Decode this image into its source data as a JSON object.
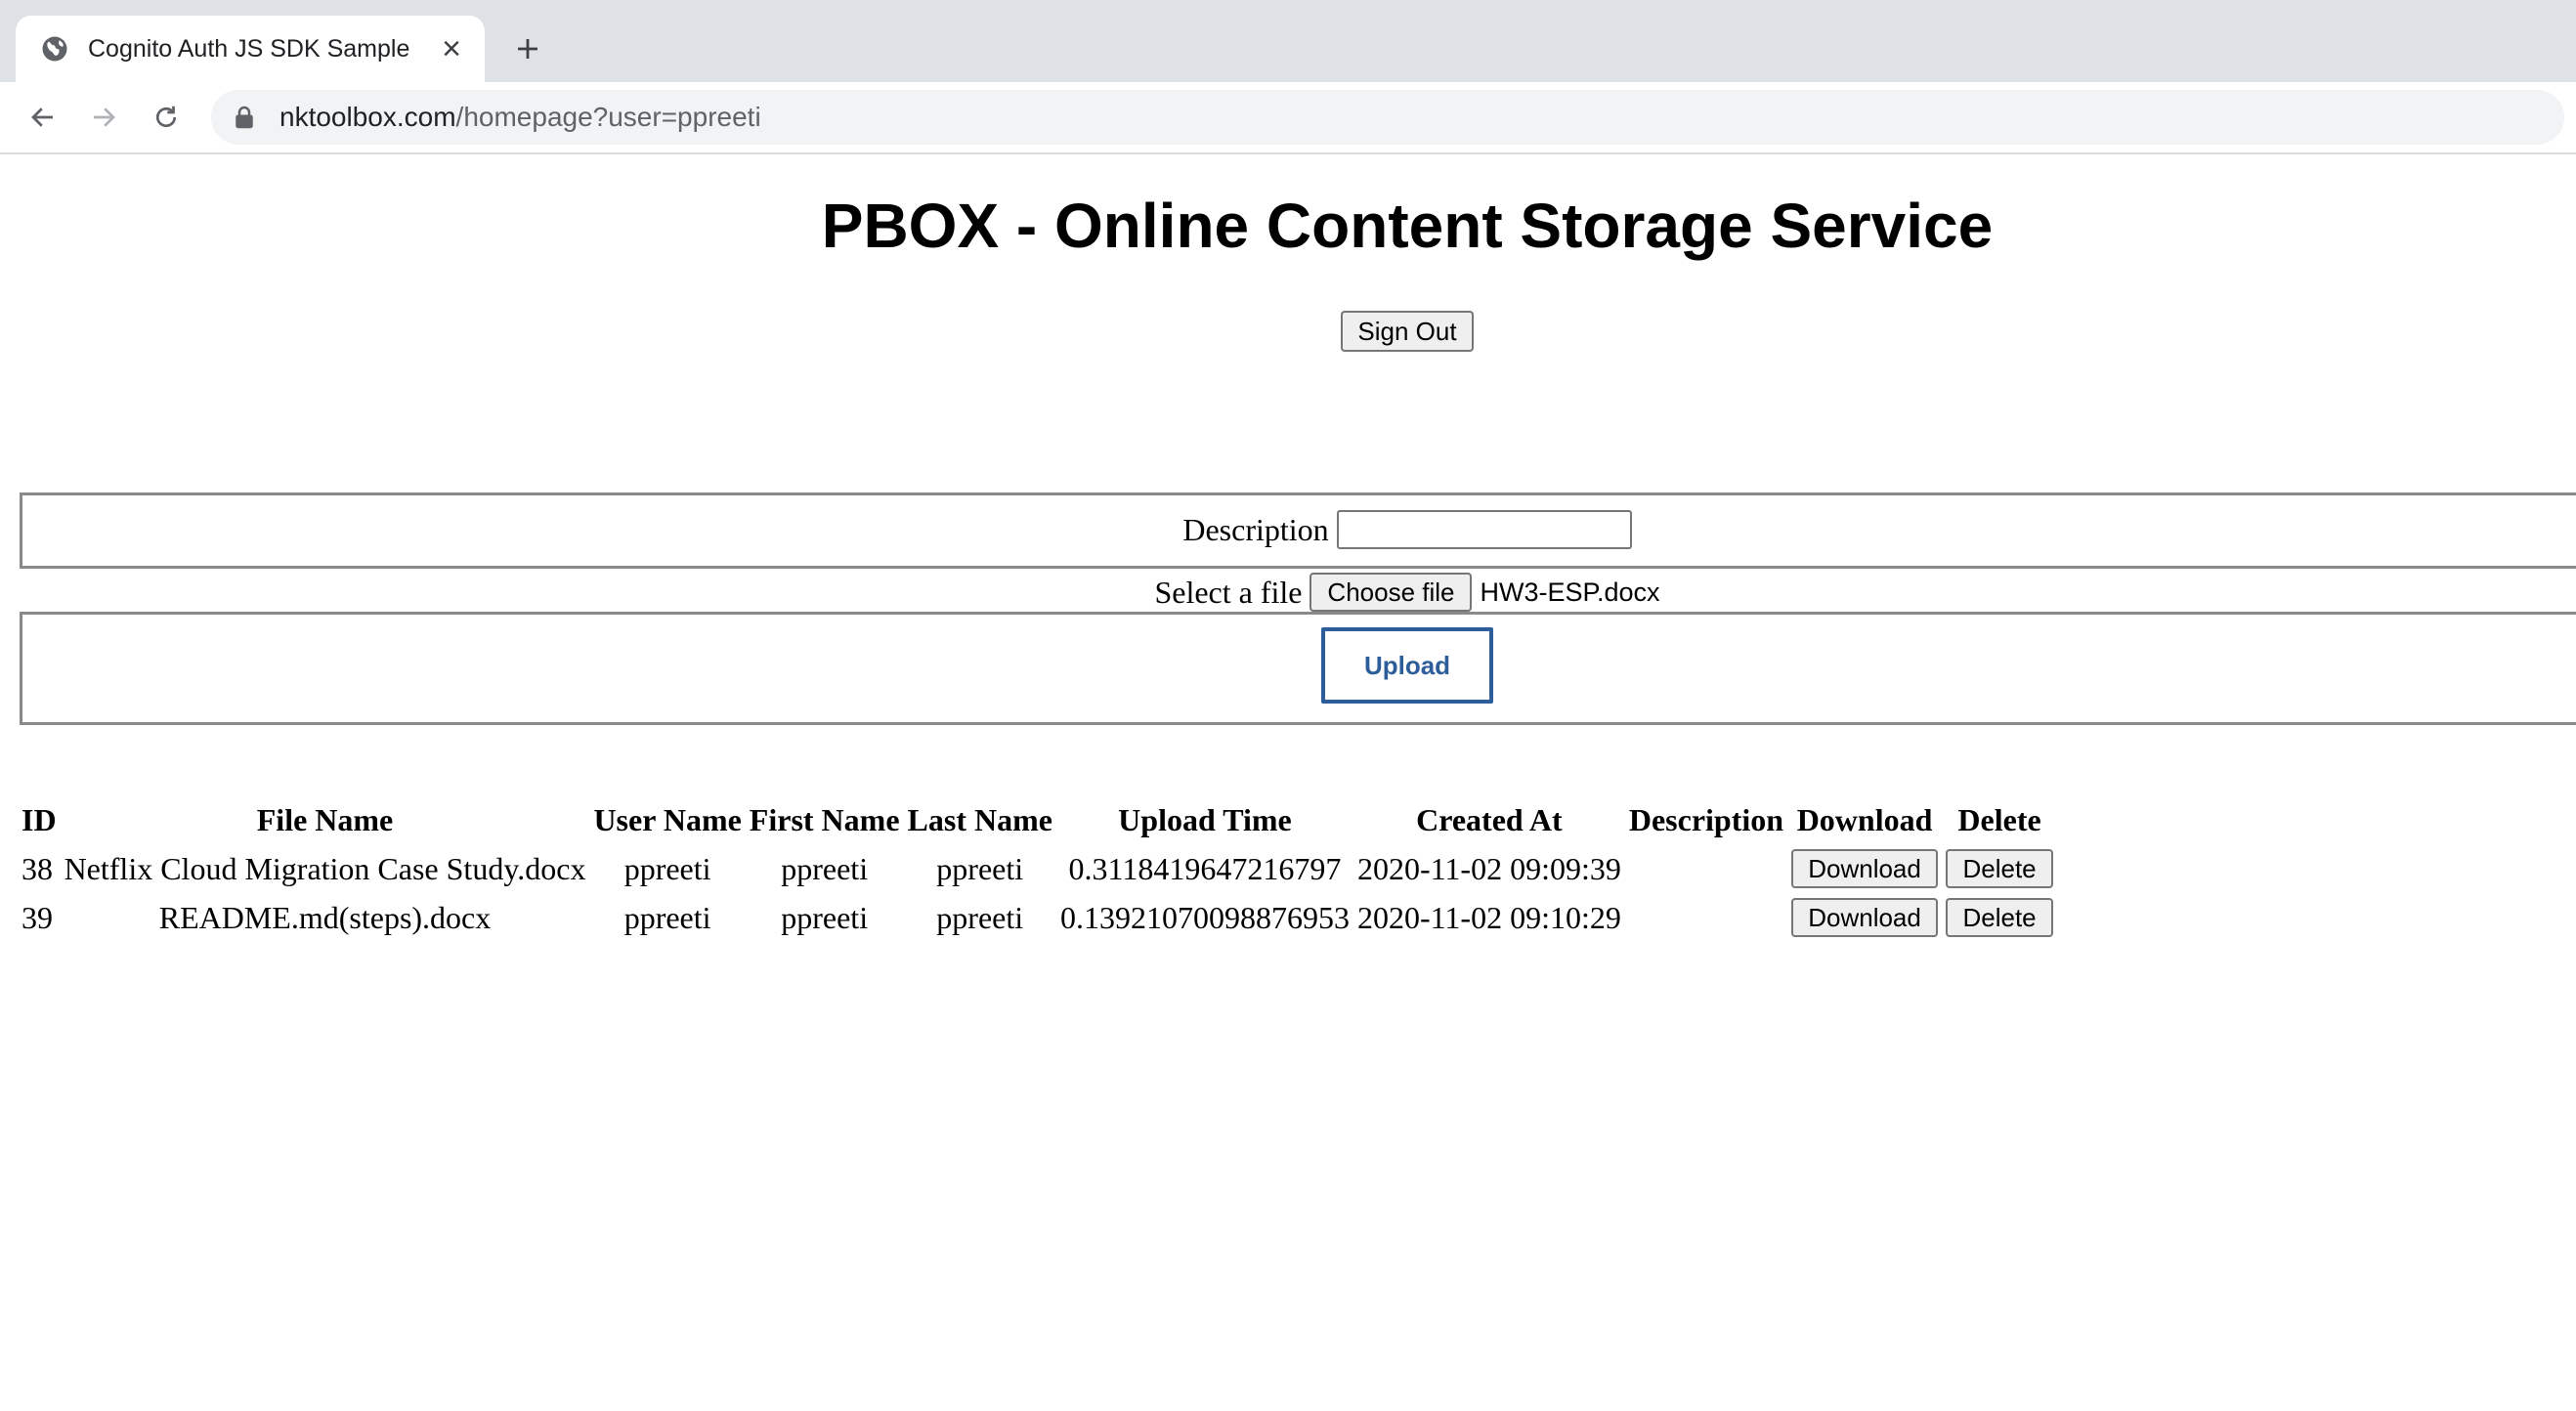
{
  "browser": {
    "tab_title": "Cognito Auth JS SDK Sample",
    "tab_icon": "globe-icon",
    "url_host": "nktoolbox.com",
    "url_path": "/homepage?user=ppreeti"
  },
  "header": {
    "title": "PBOX - Online Content Storage Service",
    "sign_out_label": "Sign Out"
  },
  "upload_form": {
    "description_label": "Description",
    "description_value": "",
    "file_label": "Select a file",
    "choose_file_label": "Choose file",
    "selected_file": "HW3-ESP.docx",
    "upload_label": "Upload",
    "accent_color": "#2d5e9a"
  },
  "table": {
    "columns": [
      "ID",
      "File Name",
      "User Name",
      "First Name",
      "Last Name",
      "Upload Time",
      "Created At",
      "Description",
      "Download",
      "Delete"
    ],
    "rows": [
      {
        "id": "38",
        "file_name": "Netflix Cloud Migration Case Study.docx",
        "user_name": "ppreeti",
        "first_name": "ppreeti",
        "last_name": "ppreeti",
        "upload_time": "0.3118419647216797",
        "created_at": "2020-11-02 09:09:39",
        "description": "",
        "download_label": "Download",
        "delete_label": "Delete"
      },
      {
        "id": "39",
        "file_name": "README.md(steps).docx",
        "user_name": "ppreeti",
        "first_name": "ppreeti",
        "last_name": "ppreeti",
        "upload_time": "0.13921070098876953",
        "created_at": "2020-11-02 09:10:29",
        "description": "",
        "download_label": "Download",
        "delete_label": "Delete"
      }
    ]
  }
}
